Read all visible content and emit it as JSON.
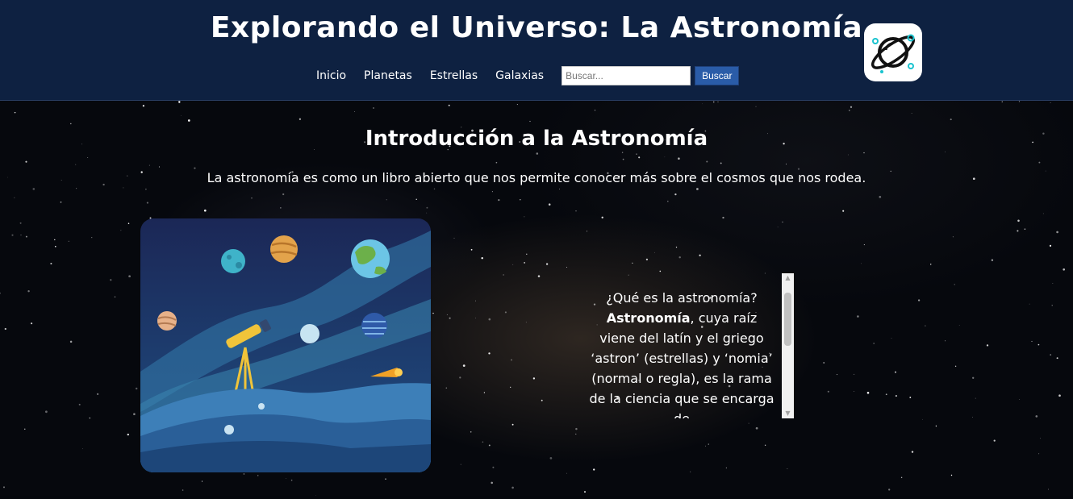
{
  "header": {
    "title": "Explorando el Universo: La Astronomía",
    "nav": [
      "Inicio",
      "Planetas",
      "Estrellas",
      "Galaxias"
    ],
    "search_placeholder": "Buscar...",
    "search_button": "Buscar",
    "logo_icon": "planet-logo-icon"
  },
  "main": {
    "section_title": "Introducción a la Astronomía",
    "intro_text": "La astronomía es como un libro abierto que nos permite conocer más sobre el cosmos que nos rodea.",
    "illustration_icon": "telescope-night-sky-illustration",
    "scroll_question": "¿Qué es la astronomía?",
    "scroll_bold": "Astronomía",
    "scroll_body": ", cuya raíz viene del latín y el griego ‘astron’ (estrellas) y ‘nomia’ (normal o regla), es la rama de la ciencia que se encarga de"
  },
  "colors": {
    "header_bg": "#0e2141",
    "page_bg": "#06080d",
    "search_button": "#2a5ca8",
    "logo_accent": "#19c3cf"
  }
}
